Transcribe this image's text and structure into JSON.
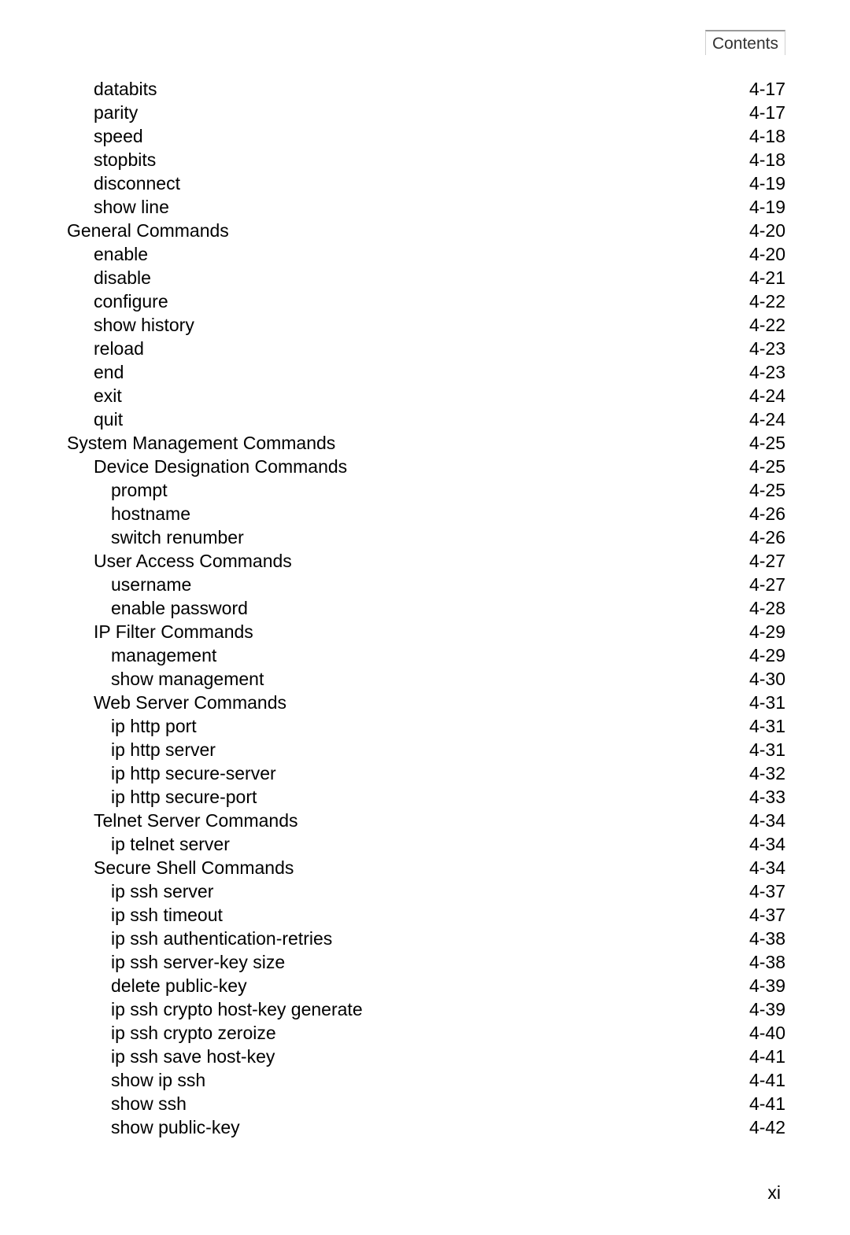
{
  "header": {
    "label": "Contents"
  },
  "footer": {
    "page_number": "xi"
  },
  "toc": [
    {
      "indent": 2,
      "title": "databits",
      "page": "4-17"
    },
    {
      "indent": 2,
      "title": "parity",
      "page": "4-17"
    },
    {
      "indent": 2,
      "title": "speed",
      "page": "4-18"
    },
    {
      "indent": 2,
      "title": "stopbits",
      "page": "4-18"
    },
    {
      "indent": 2,
      "title": "disconnect",
      "page": "4-19"
    },
    {
      "indent": 2,
      "title": "show line",
      "page": "4-19"
    },
    {
      "indent": 1,
      "title": "General Commands",
      "page": "4-20"
    },
    {
      "indent": 2,
      "title": "enable",
      "page": "4-20"
    },
    {
      "indent": 2,
      "title": "disable",
      "page": "4-21"
    },
    {
      "indent": 2,
      "title": "configure",
      "page": "4-22"
    },
    {
      "indent": 2,
      "title": "show history",
      "page": "4-22"
    },
    {
      "indent": 2,
      "title": "reload",
      "page": "4-23"
    },
    {
      "indent": 2,
      "title": "end",
      "page": "4-23"
    },
    {
      "indent": 2,
      "title": "exit",
      "page": "4-24"
    },
    {
      "indent": 2,
      "title": "quit",
      "page": "4-24"
    },
    {
      "indent": 1,
      "title": "System Management Commands",
      "page": "4-25"
    },
    {
      "indent": 2,
      "title": "Device Designation Commands",
      "page": "4-25"
    },
    {
      "indent": 3,
      "title": "prompt",
      "page": "4-25"
    },
    {
      "indent": 3,
      "title": "hostname",
      "page": "4-26"
    },
    {
      "indent": 3,
      "title": "switch renumber",
      "page": "4-26"
    },
    {
      "indent": 2,
      "title": "User Access Commands",
      "page": "4-27"
    },
    {
      "indent": 3,
      "title": "username",
      "page": "4-27"
    },
    {
      "indent": 3,
      "title": "enable password",
      "page": "4-28"
    },
    {
      "indent": 2,
      "title": "IP Filter Commands",
      "page": "4-29"
    },
    {
      "indent": 3,
      "title": "management",
      "page": "4-29"
    },
    {
      "indent": 3,
      "title": "show management",
      "page": "4-30"
    },
    {
      "indent": 2,
      "title": "Web Server Commands",
      "page": "4-31"
    },
    {
      "indent": 3,
      "title": "ip http port",
      "page": "4-31"
    },
    {
      "indent": 3,
      "title": "ip http server",
      "page": "4-31"
    },
    {
      "indent": 3,
      "title": "ip http secure-server",
      "page": "4-32"
    },
    {
      "indent": 3,
      "title": "ip http secure-port",
      "page": "4-33"
    },
    {
      "indent": 2,
      "title": "Telnet Server Commands",
      "page": "4-34"
    },
    {
      "indent": 3,
      "title": "ip telnet server",
      "page": "4-34"
    },
    {
      "indent": 2,
      "title": "Secure Shell Commands",
      "page": "4-34"
    },
    {
      "indent": 3,
      "title": "ip ssh server",
      "page": "4-37"
    },
    {
      "indent": 3,
      "title": "ip ssh timeout",
      "page": "4-37"
    },
    {
      "indent": 3,
      "title": "ip ssh authentication-retries",
      "page": "4-38"
    },
    {
      "indent": 3,
      "title": "ip ssh server-key size",
      "page": "4-38"
    },
    {
      "indent": 3,
      "title": "delete public-key",
      "page": "4-39"
    },
    {
      "indent": 3,
      "title": "ip ssh crypto host-key generate",
      "page": "4-39"
    },
    {
      "indent": 3,
      "title": "ip ssh crypto zeroize",
      "page": "4-40"
    },
    {
      "indent": 3,
      "title": "ip ssh save host-key",
      "page": "4-41"
    },
    {
      "indent": 3,
      "title": "show ip ssh",
      "page": "4-41"
    },
    {
      "indent": 3,
      "title": "show ssh",
      "page": "4-41"
    },
    {
      "indent": 3,
      "title": "show public-key",
      "page": "4-42"
    }
  ]
}
